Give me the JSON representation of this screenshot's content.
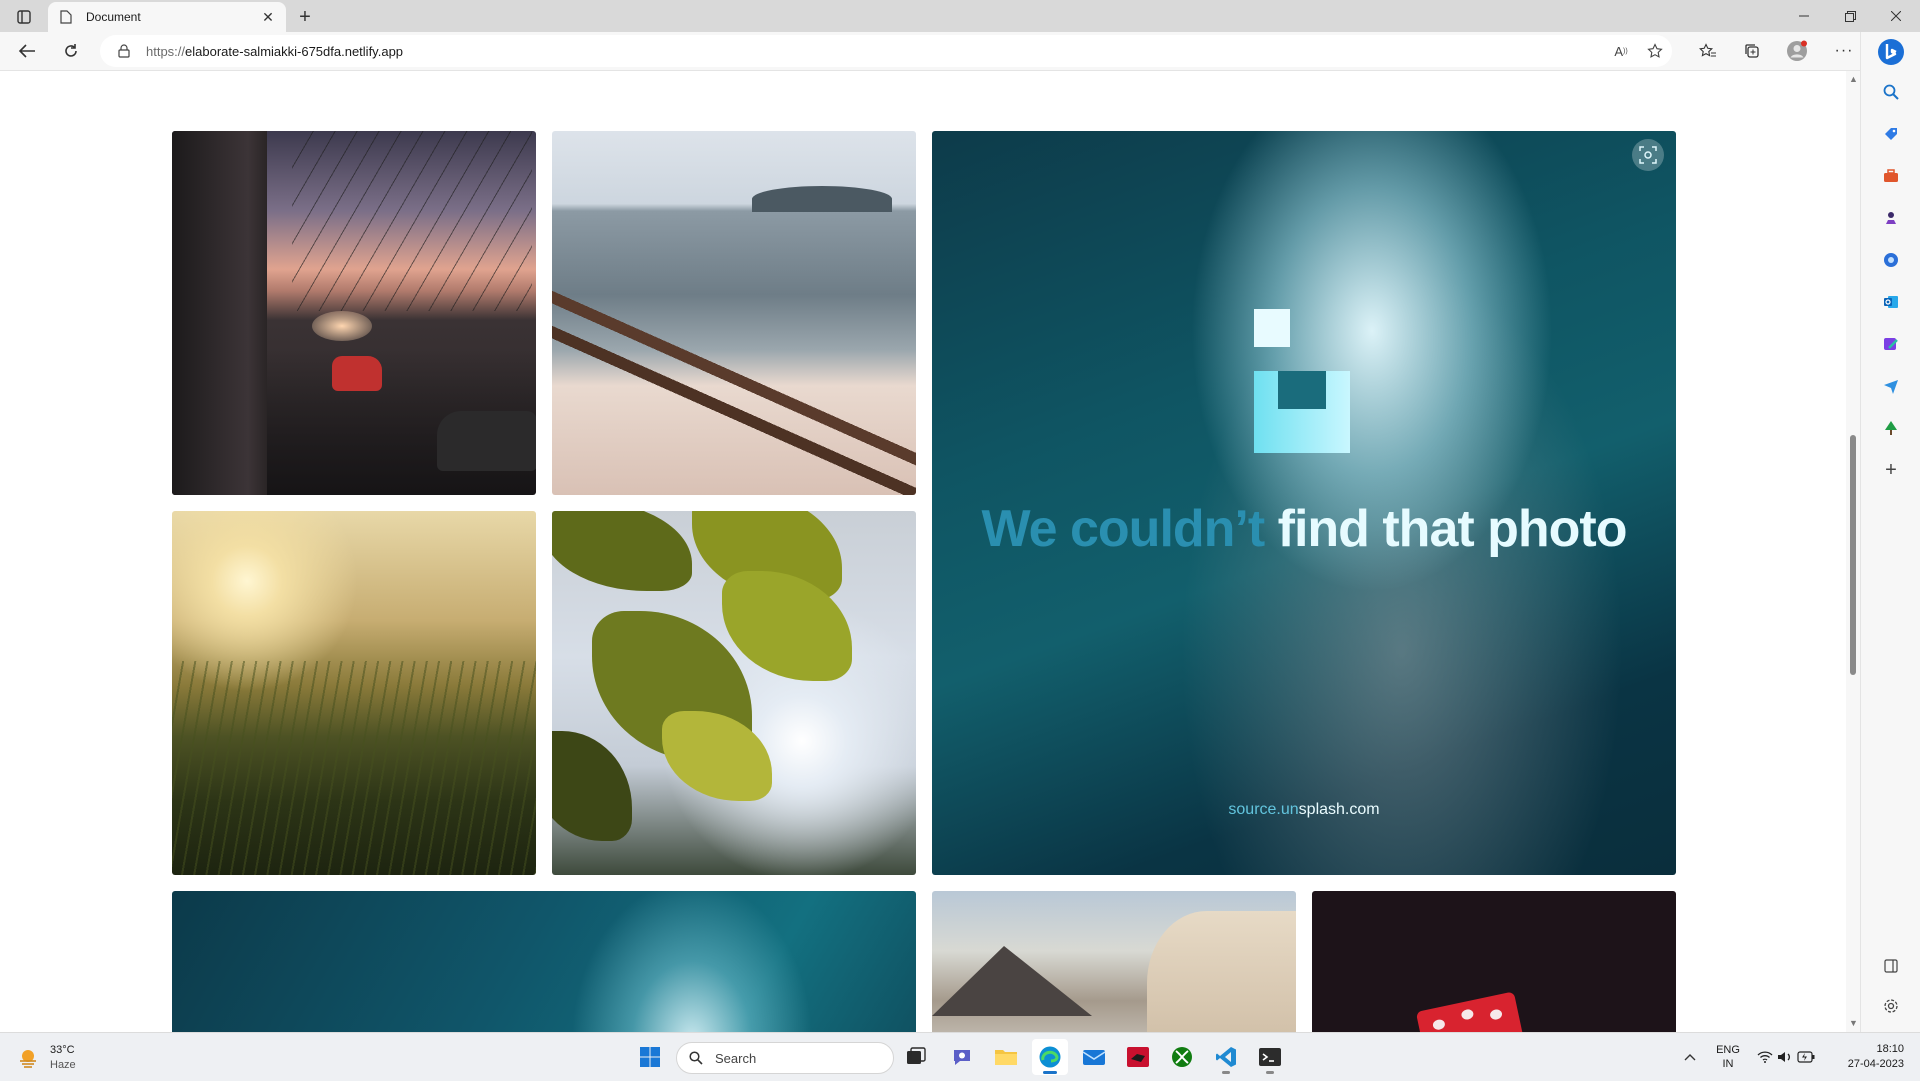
{
  "browser": {
    "tab_title": "Document",
    "url_scheme": "https://",
    "url_host": "elaborate-salmiakki-675dfa.netlify.app"
  },
  "page": {
    "error_image": {
      "message_part1": "We couldn’t ",
      "message_part2": "find that photo",
      "source_part1": "source.un",
      "source_part2": "splash.com"
    }
  },
  "taskbar": {
    "weather_temp": "33°C",
    "weather_cond": "Haze",
    "search_placeholder": "Search",
    "lang_top": "ENG",
    "lang_bottom": "IN",
    "time": "18:10",
    "date": "27-04-2023"
  },
  "colors": {
    "edge_accent": "#1a73c9",
    "error_text_dim": "#2a8fb0",
    "error_text_bright": "#e6fbff"
  }
}
